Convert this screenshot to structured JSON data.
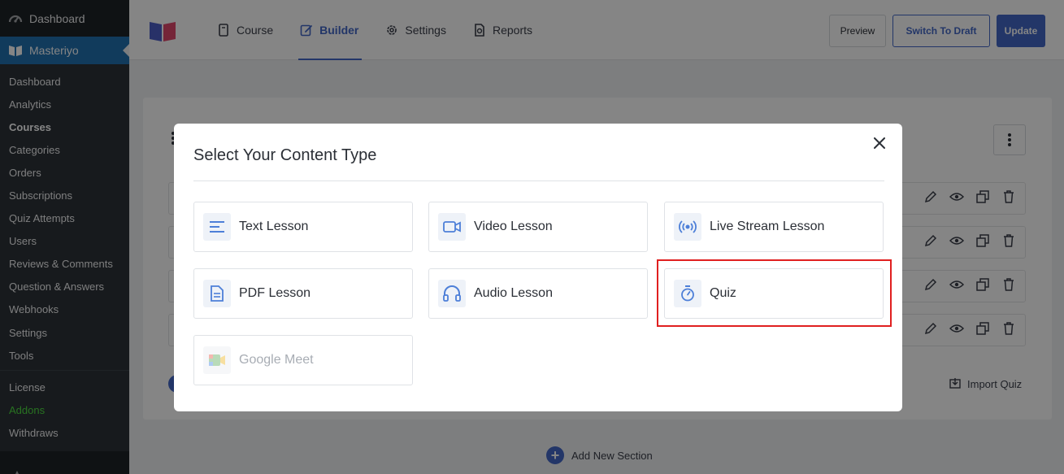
{
  "sidebar": {
    "top_label": "Dashboard",
    "active_label": "Masteriyo",
    "items": [
      {
        "label": "Dashboard"
      },
      {
        "label": "Analytics"
      },
      {
        "label": "Courses"
      },
      {
        "label": "Categories"
      },
      {
        "label": "Orders"
      },
      {
        "label": "Subscriptions"
      },
      {
        "label": "Quiz Attempts"
      },
      {
        "label": "Users"
      },
      {
        "label": "Reviews & Comments"
      },
      {
        "label": "Question & Answers"
      },
      {
        "label": "Webhooks"
      },
      {
        "label": "Settings"
      },
      {
        "label": "Tools"
      }
    ],
    "items2": [
      {
        "label": "License"
      },
      {
        "label": "Addons"
      },
      {
        "label": "Withdraws"
      }
    ]
  },
  "header": {
    "tabs": [
      {
        "label": "Course"
      },
      {
        "label": "Builder"
      },
      {
        "label": "Settings"
      },
      {
        "label": "Reports"
      }
    ],
    "preview_label": "Preview",
    "draft_label": "Switch To Draft",
    "update_label": "Update"
  },
  "builder": {
    "import_quiz_label": "Import Quiz",
    "add_section_label": "Add New Section"
  },
  "modal": {
    "title": "Select Your Content Type",
    "types": [
      {
        "label": "Text Lesson",
        "icon": "text-lines-icon"
      },
      {
        "label": "Video Lesson",
        "icon": "video-camera-icon"
      },
      {
        "label": "Live Stream Lesson",
        "icon": "broadcast-icon"
      },
      {
        "label": "PDF Lesson",
        "icon": "document-icon"
      },
      {
        "label": "Audio Lesson",
        "icon": "headphones-icon"
      },
      {
        "label": "Quiz",
        "icon": "stopwatch-icon"
      },
      {
        "label": "Google Meet",
        "icon": "google-meet-icon",
        "disabled": true
      }
    ]
  },
  "colors": {
    "accent": "#4368c8",
    "sidebar_bg": "#1d2327",
    "wp_blue": "#2271b1",
    "highlight": "#e02020"
  }
}
